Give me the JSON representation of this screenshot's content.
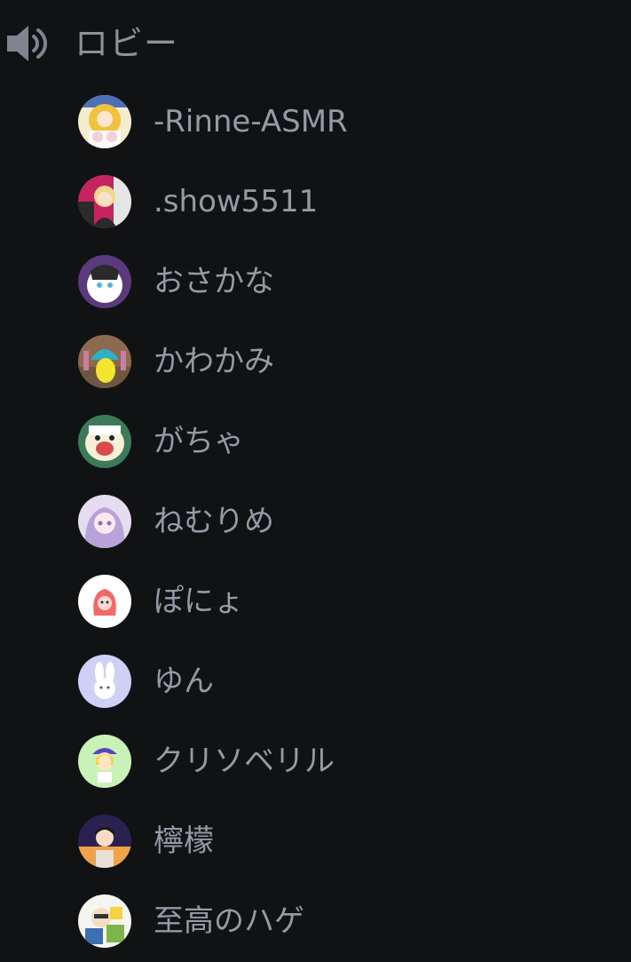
{
  "channel": {
    "icon": "speaker-icon",
    "name": "ロビー"
  },
  "users": [
    {
      "name": "-Rinne-ASMR",
      "avatar_icon": "user-avatar"
    },
    {
      "name": ".show5511",
      "avatar_icon": "user-avatar"
    },
    {
      "name": "おさかな",
      "avatar_icon": "user-avatar"
    },
    {
      "name": "かわかみ",
      "avatar_icon": "user-avatar"
    },
    {
      "name": "がちゃ",
      "avatar_icon": "user-avatar"
    },
    {
      "name": "ねむりめ",
      "avatar_icon": "user-avatar"
    },
    {
      "name": "ぽにょ",
      "avatar_icon": "user-avatar"
    },
    {
      "name": "ゆん",
      "avatar_icon": "user-avatar"
    },
    {
      "name": "クリソベリル",
      "avatar_icon": "user-avatar"
    },
    {
      "name": "檸檬",
      "avatar_icon": "user-avatar"
    },
    {
      "name": "至高のハゲ",
      "avatar_icon": "user-avatar"
    }
  ],
  "colors": {
    "background": "#111214",
    "text": "#949ba4",
    "icon": "#80848e"
  }
}
